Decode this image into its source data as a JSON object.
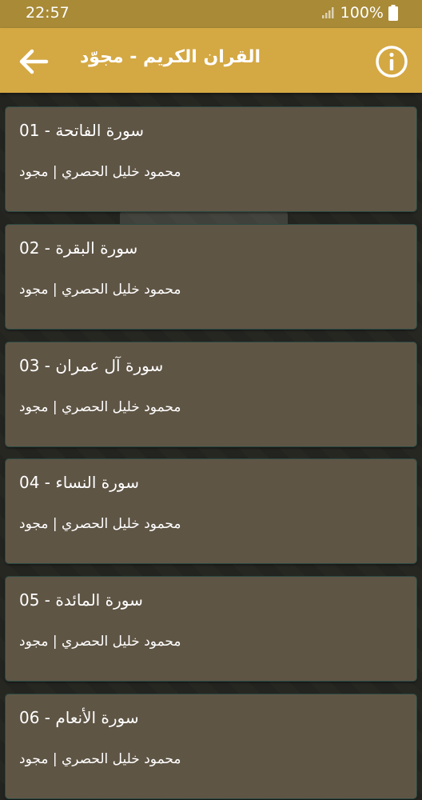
{
  "status_bar": {
    "time": "22:57",
    "battery": "100%"
  },
  "app_bar": {
    "title": "القران الكريم - مجوّد"
  },
  "surahs": [
    {
      "number": "01",
      "name": "سورة الفاتحة",
      "reciter": "محمود خليل الحصري | مجود"
    },
    {
      "number": "02",
      "name": "سورة البقرة",
      "reciter": "محمود خليل الحصري | مجود"
    },
    {
      "number": "03",
      "name": "سورة آل عمران",
      "reciter": "محمود خليل الحصري | مجود"
    },
    {
      "number": "04",
      "name": "سورة النساء",
      "reciter": "محمود خليل الحصري | مجود"
    },
    {
      "number": "05",
      "name": "سورة المائدة",
      "reciter": "محمود خليل الحصري | مجود"
    },
    {
      "number": "06",
      "name": "سورة الأنعام",
      "reciter": "محمود خليل الحصري | مجود"
    }
  ],
  "colors": {
    "status_bar": "#a88a37",
    "app_bar": "#d4a843",
    "card": "#5f5545",
    "text": "#ffffff"
  }
}
